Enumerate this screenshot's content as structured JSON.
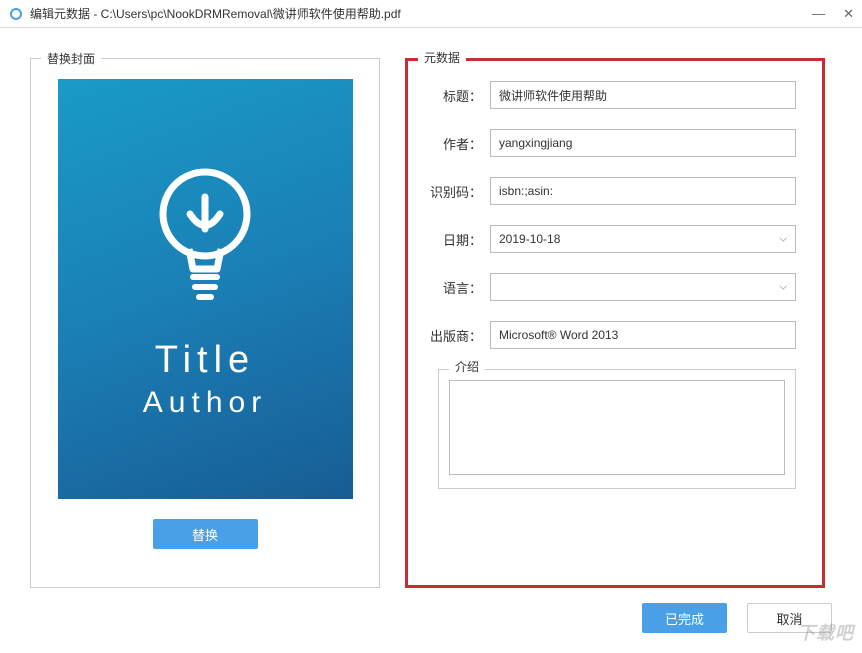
{
  "window": {
    "title": "编辑元数据 - C:\\Users\\pc\\NookDRMRemoval\\微讲师软件使用帮助.pdf",
    "minimize": "—",
    "close": "✕"
  },
  "cover": {
    "panel_label": "替换封面",
    "title_text": "Title",
    "author_text": "Author",
    "replace_button": "替换"
  },
  "metadata": {
    "panel_label": "元数据",
    "fields": {
      "title_label": "标题：",
      "title_value": "微讲师软件使用帮助",
      "author_label": "作者：",
      "author_value": "yangxingjiang",
      "identifier_label": "识别码：",
      "identifier_value": "isbn:;asin:",
      "date_label": "日期：",
      "date_value": "2019-10-18",
      "language_label": "语言：",
      "language_value": "",
      "publisher_label": "出版商：",
      "publisher_value": "Microsoft® Word 2013"
    },
    "intro": {
      "label": "介绍",
      "value": ""
    }
  },
  "buttons": {
    "done": "已完成",
    "cancel": "取消"
  },
  "watermark": "下载吧"
}
